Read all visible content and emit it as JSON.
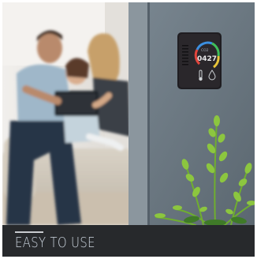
{
  "caption": {
    "text": "EASY TO USE",
    "rule_color": "#c9ccd0",
    "text_color": "#cfd8e2",
    "bar_color": "#27292c"
  },
  "device": {
    "co2_label": "CO2",
    "reading": "0427",
    "ring_colors": [
      "#3fbf5a",
      "#e8c53a",
      "#e2453c",
      "#3b8fe0"
    ],
    "left_icon": "thermometer-icon",
    "right_icon": "droplet-icon"
  },
  "scene": {
    "wall_color": "#6d7a84",
    "living_room_tone": "#e9e6e1",
    "plant_color": "#8cc63f"
  }
}
